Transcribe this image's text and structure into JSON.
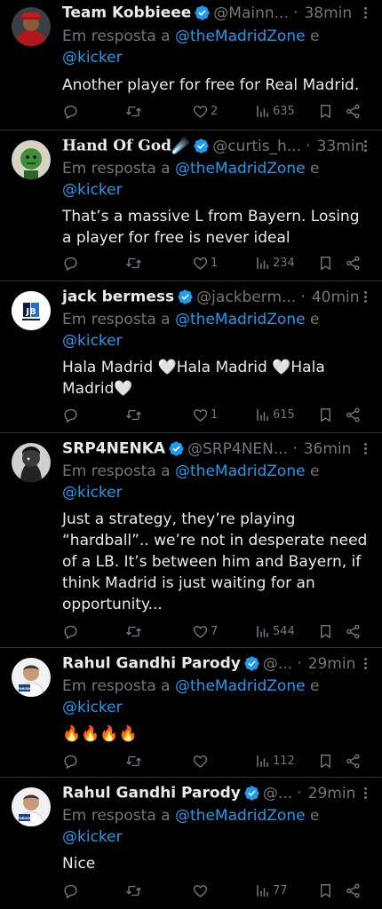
{
  "reply_prefix": "Em resposta a",
  "and_word": "e",
  "reply_to_1": "@theMadridZone",
  "reply_to_2": "@kicker",
  "tweets": [
    {
      "name": "Team Kobbieee",
      "handle": "@Mainn...",
      "dot": "·",
      "time": "38min",
      "text": "Another player for free for Real Madrid.",
      "likes": "2",
      "views": "635"
    },
    {
      "name": "Hand Of God☄️",
      "handle": "@curtis_h...",
      "dot": "·",
      "time": "33min",
      "text": "That’s a massive L from Bayern. Losing a player for free is never ideal",
      "likes": "1",
      "views": "234"
    },
    {
      "name": "jack bermess",
      "handle": "@jackberm...",
      "dot": "·",
      "time": "40min",
      "text": "Hala Madrid 🤍Hala Madrid 🤍Hala Madrid🤍",
      "likes": "1",
      "views": "615"
    },
    {
      "name": "SRP4NENKA",
      "handle": "@SRP4NEN...",
      "dot": "·",
      "time": "36min",
      "text": "Just a strategy, they’re playing “hardball”.. we’re not in desperate need of a LB. It’s between him and Bayern, if think Madrid is just waiting for an opportunity...",
      "likes": "7",
      "views": "544"
    },
    {
      "name": "Rahul Gandhi Parody",
      "handle": "@...",
      "dot": "·",
      "time": "29min",
      "text": "🔥🔥🔥🔥",
      "likes": "",
      "views": "112"
    },
    {
      "name": "Rahul Gandhi Parody",
      "handle": "@...",
      "dot": "·",
      "time": "29min",
      "text": "Nice",
      "likes": "",
      "views": "77"
    }
  ],
  "avatar_logo_text": "JB",
  "avatar_parody_badge": "PARODY",
  "colors": {
    "background": "#000000",
    "text": "#e7e9ea",
    "muted": "#71767b",
    "link": "#1d9bf0",
    "verified": "#1d9bf0",
    "divider": "#2f3336"
  }
}
